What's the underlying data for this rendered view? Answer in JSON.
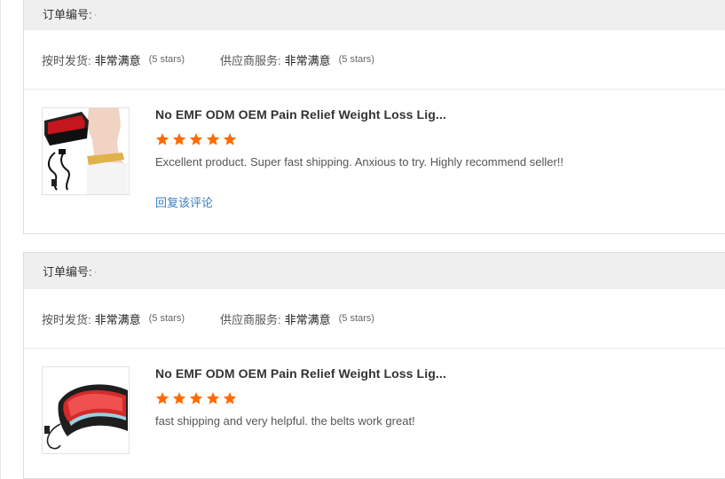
{
  "orders": [
    {
      "order_no_label": "订单编号:",
      "order_no_value": "·",
      "ratings": [
        {
          "label": "按时发货:",
          "value": "非常满意",
          "stars": "(5 stars)"
        },
        {
          "label": "供应商服务:",
          "value": "非常满意",
          "stars": "(5 stars)"
        }
      ],
      "product_title": "No EMF ODM OEM Pain Relief Weight Loss Lig...",
      "rating_stars": 5,
      "feedback": "Excellent product. Super fast shipping. Anxious to try. Highly recommend seller!!",
      "reply_label": "回复该评论",
      "thumbnail_icon": "waist-belt-with-model-image"
    },
    {
      "order_no_label": "订单编号:",
      "order_no_value": "·",
      "ratings": [
        {
          "label": "按时发货:",
          "value": "非常满意",
          "stars": "(5 stars)"
        },
        {
          "label": "供应商服务:",
          "value": "非常满意",
          "stars": "(5 stars)"
        }
      ],
      "product_title": "No EMF ODM OEM Pain Relief Weight Loss Lig...",
      "rating_stars": 5,
      "feedback": "fast shipping and very helpful. the belts work great!",
      "reply_label": "",
      "thumbnail_icon": "red-light-belt-image"
    }
  ],
  "colors": {
    "star": "#ff6a00",
    "link": "#3a7fc1",
    "header_bg": "#efefef"
  }
}
